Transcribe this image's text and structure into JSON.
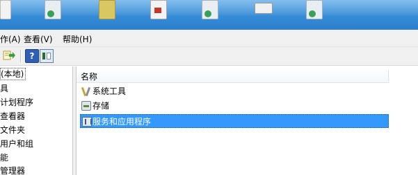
{
  "menu": {
    "action": "作(A)",
    "view": "查看(V)",
    "help": "帮助(H)"
  },
  "tree": {
    "root": "(本地)",
    "items": [
      "具",
      "计划程序",
      "查看器",
      "文件夹",
      "用户和组",
      "能",
      "管理器"
    ]
  },
  "list": {
    "column_name": "名称",
    "rows": [
      {
        "label": "系统工具",
        "icon": "tools-icon"
      },
      {
        "label": "存储",
        "icon": "storage-icon"
      },
      {
        "label": "服务和应用程序",
        "icon": "services-apps-icon",
        "selected": true
      }
    ]
  },
  "colors": {
    "selection": "#3399ff",
    "taskbar": "#3a8fd8"
  }
}
